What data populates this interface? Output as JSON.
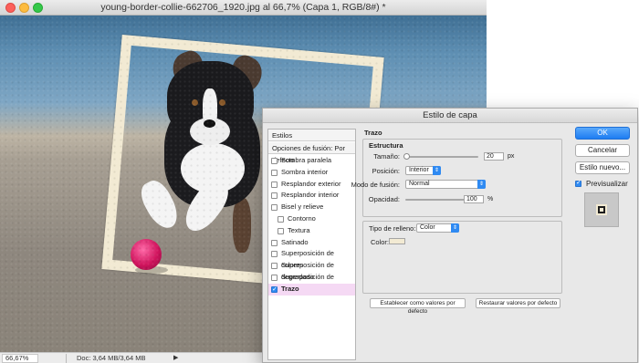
{
  "document": {
    "title": "young-border-collie-662706_1920.jpg al 66,7% (Capa 1, RGB/8#) *",
    "zoom": "66,67%",
    "doc_info": "Doc: 3,64 MB/3,64 MB",
    "status_arrow": "▶"
  },
  "dialog": {
    "title": "Estilo de capa",
    "styles_header": "Estilos",
    "blend_defaults": "Opciones de fusión: Por defecto",
    "style_items": [
      {
        "label": "Sombra paralela",
        "checked": false,
        "indent": false,
        "selected": false
      },
      {
        "label": "Sombra interior",
        "checked": false,
        "indent": false,
        "selected": false
      },
      {
        "label": "Resplandor exterior",
        "checked": false,
        "indent": false,
        "selected": false
      },
      {
        "label": "Resplandor interior",
        "checked": false,
        "indent": false,
        "selected": false
      },
      {
        "label": "Bisel y relieve",
        "checked": false,
        "indent": false,
        "selected": false
      },
      {
        "label": "Contorno",
        "checked": false,
        "indent": true,
        "selected": false
      },
      {
        "label": "Textura",
        "checked": false,
        "indent": true,
        "selected": false
      },
      {
        "label": "Satinado",
        "checked": false,
        "indent": false,
        "selected": false
      },
      {
        "label": "Superposición de colores",
        "checked": false,
        "indent": false,
        "selected": false
      },
      {
        "label": "Superposición de degradado",
        "checked": false,
        "indent": false,
        "selected": false
      },
      {
        "label": "Superposición de motivo",
        "checked": false,
        "indent": false,
        "selected": false
      },
      {
        "label": "Trazo",
        "checked": true,
        "indent": false,
        "selected": true
      }
    ],
    "trazo": {
      "title": "Trazo",
      "estructura_title": "Estructura",
      "size_label": "Tamaño:",
      "size_value": "20",
      "size_unit": "px",
      "position_label": "Posición:",
      "position_value": "Interior",
      "blend_mode_label": "Modo de fusión:",
      "blend_mode_value": "Normal",
      "opacity_label": "Opacidad:",
      "opacity_value": "100",
      "opacity_unit": "%",
      "fill_type_label": "Tipo de relleno:",
      "fill_type_value": "Color",
      "color_label": "Color:",
      "color_value": "#f2ead3",
      "set_default_button": "Establecer como valores por defecto",
      "reset_default_button": "Restaurar valores por defecto"
    },
    "buttons": {
      "ok": "OK",
      "cancel": "Cancelar",
      "new_style": "Estilo nuevo...",
      "preview": "Previsualizar",
      "preview_checked": true
    }
  },
  "colors": {
    "accent": "#2f8af2",
    "selected_row": "#f5d9f4",
    "frame": "#f2ead3"
  }
}
